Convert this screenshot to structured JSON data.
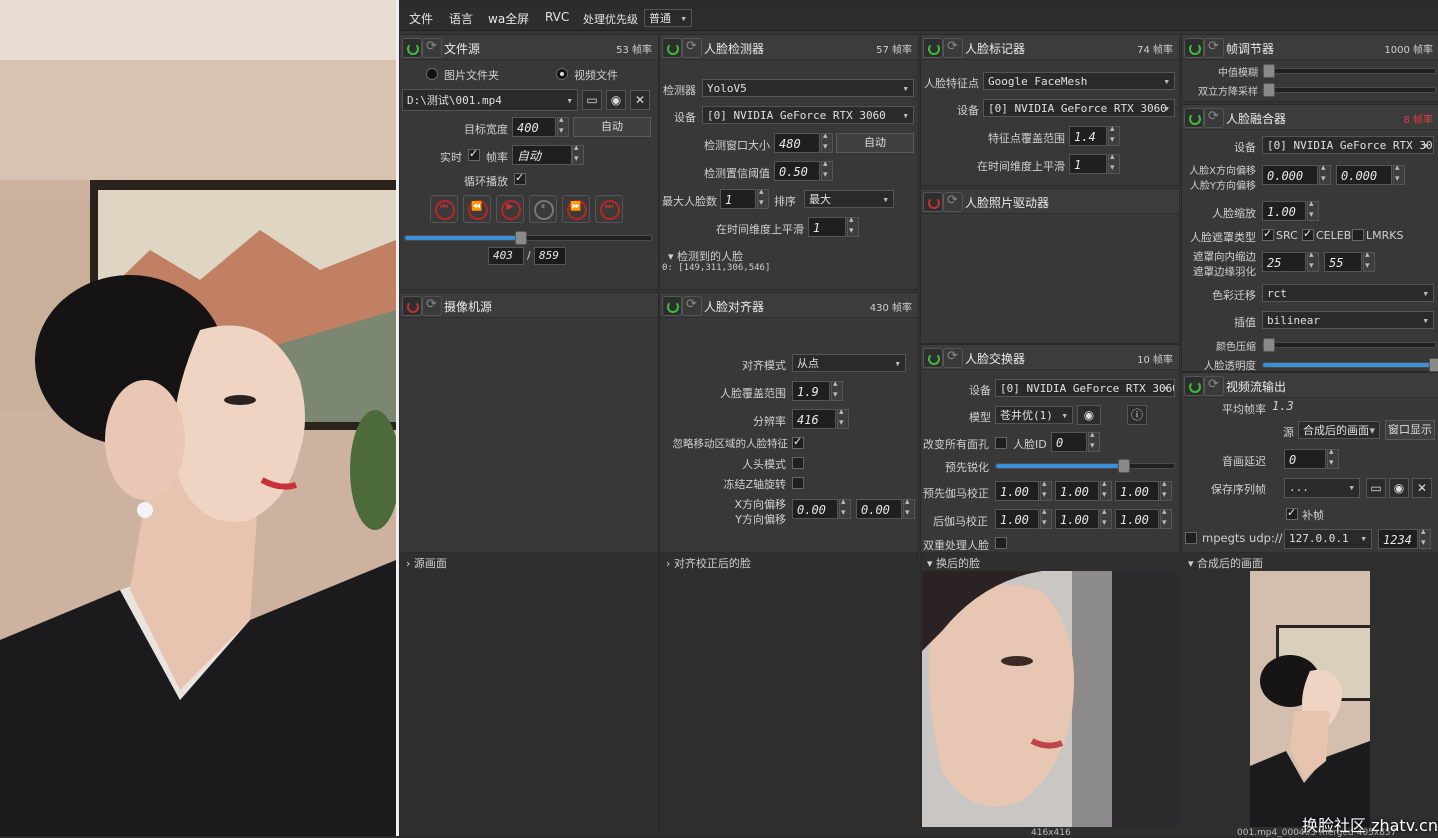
{
  "menu": {
    "file": "文件",
    "language": "语言",
    "fullscreen": "wa全屏",
    "rvc": "RVC",
    "priority_label": "处理优先级",
    "priority_value": "普通"
  },
  "file_source": {
    "title": "文件源",
    "fps": "53 帧率",
    "opt_image_folder": "图片文件夹",
    "opt_video_file": "视频文件",
    "path": "D:\\测试\\001.mp4",
    "target_width_label": "目标宽度",
    "target_width_value": "400",
    "auto_label": "自动",
    "realtime_label": "实时",
    "fps_label": "帧率",
    "fps_value": "自动",
    "loop_label": "循环播放",
    "progress": 0.47,
    "frame_current": "403",
    "frame_sep": "/",
    "frame_total": "859"
  },
  "camera_source": {
    "title": "摄像机源"
  },
  "face_detector": {
    "title": "人脸检测器",
    "fps": "57 帧率",
    "detector_label": "检测器",
    "detector_value": "YoloV5",
    "device_label": "设备",
    "device_value": "[0] NVIDIA GeForce RTX 3060",
    "window_label": "检测窗口大小",
    "window_value": "480",
    "auto_label": "自动",
    "threshold_label": "检测置信阈值",
    "threshold_value": "0.50",
    "max_faces_label": "最大人脸数",
    "max_faces_value": "1",
    "sort_label": "排序",
    "sort_value": "最大",
    "smooth_label": "在时间维度上平滑",
    "smooth_value": "1",
    "detected_label": "检测到的人脸",
    "detected_value": "0: [149,311,306,546]"
  },
  "face_aligner": {
    "title": "人脸对齐器",
    "fps": "430 帧率",
    "mode_label": "对齐模式",
    "mode_value": "从点",
    "coverage_label": "人脸覆盖范围",
    "coverage_value": "1.9",
    "resolution_label": "分辨率",
    "resolution_value": "416",
    "ignore_moving_label": "忽略移动区域的人脸特征",
    "head_mode_label": "人头模式",
    "freeze_z_label": "冻结Z轴旋转",
    "x_offset_label": "X方向偏移",
    "y_offset_label": "Y方向偏移",
    "x_offset_value": "0.00",
    "y_offset_value": "0.00"
  },
  "face_marker": {
    "title": "人脸标记器",
    "fps": "74 帧率",
    "landmark_label": "人脸特征点",
    "landmark_value": "Google FaceMesh",
    "device_label": "设备",
    "device_value": "[0] NVIDIA GeForce RTX 3060",
    "range_label": "特征点覆盖范围",
    "range_value": "1.4",
    "smooth_label": "在时间维度上平滑",
    "smooth_value": "1"
  },
  "face_animator": {
    "title": "人脸照片驱动器"
  },
  "face_swapper": {
    "title": "人脸交换器",
    "fps": "10 帧率",
    "device_label": "设备",
    "device_value": "[0] NVIDIA GeForce RTX 3060",
    "model_label": "模型",
    "model_value": "苍井优(1)",
    "swap_all_label": "改变所有面孔",
    "face_id_label": "人脸ID",
    "face_id_value": "0",
    "presharpen_label": "预先锐化",
    "presharpen": 0.72,
    "pre_gamma_label": "预先伽马校正",
    "post_gamma_label": "后伽马校正",
    "gamma_values": [
      "1.00",
      "1.00",
      "1.00"
    ],
    "two_pass_label": "双重处理人脸"
  },
  "frame_adjuster": {
    "title": "帧调节器",
    "fps": "1000 帧率",
    "median_label": "中值模糊",
    "bilateral_label": "双立方降采样"
  },
  "face_merger": {
    "title": "人脸融合器",
    "fps": "8 帧率",
    "device_label": "设备",
    "device_value": "[0] NVIDIA GeForce RTX 3060",
    "x_offset_label": "人脸X方向偏移",
    "y_offset_label": "人脸Y方向偏移",
    "x_offset_value": "0.000",
    "y_offset_value": "0.000",
    "scale_label": "人脸缩放",
    "scale_value": "1.00",
    "mask_type_label": "人脸遮罩类型",
    "mask_src": "SRC",
    "mask_celeb": "CELEB",
    "mask_lmrks": "LMRKS",
    "erode_label": "遮罩向内缩边",
    "blur_label": "遮罩边缘羽化",
    "erode_value": "25",
    "blur_value": "55",
    "color_transfer_label": "色彩迁移",
    "color_transfer_value": "rct",
    "interp_label": "插值",
    "interp_value": "bilinear",
    "color_compress_label": "颜色压缩",
    "opacity_label": "人脸透明度",
    "opacity": 1.0
  },
  "stream_output": {
    "title": "视频流输出",
    "avg_fps_label": "平均帧率",
    "avg_fps_value": "1.3",
    "source_label": "源",
    "source_value": "合成后的画面",
    "window_label": "窗口显示",
    "delay_label": "音画延迟",
    "delay_value": "0",
    "save_seq_label": "保存序列帧",
    "save_seq_value": "...",
    "fill_frames_label": "补帧",
    "mpegts_label": "mpegts udp://",
    "mpegts_host": "127.0.0.1",
    "mpegts_port": "1234"
  },
  "previews": {
    "source_frame": "源画面",
    "aligned_face": "对齐校正后的脸",
    "swapped_face": "换后的脸",
    "merged_frame": "合成后的画面",
    "swapped_caption": "416x416",
    "merged_caption": "001.mp4_000403 merged 405x857"
  },
  "watermark": "换脸社区 zhatv.cn"
}
